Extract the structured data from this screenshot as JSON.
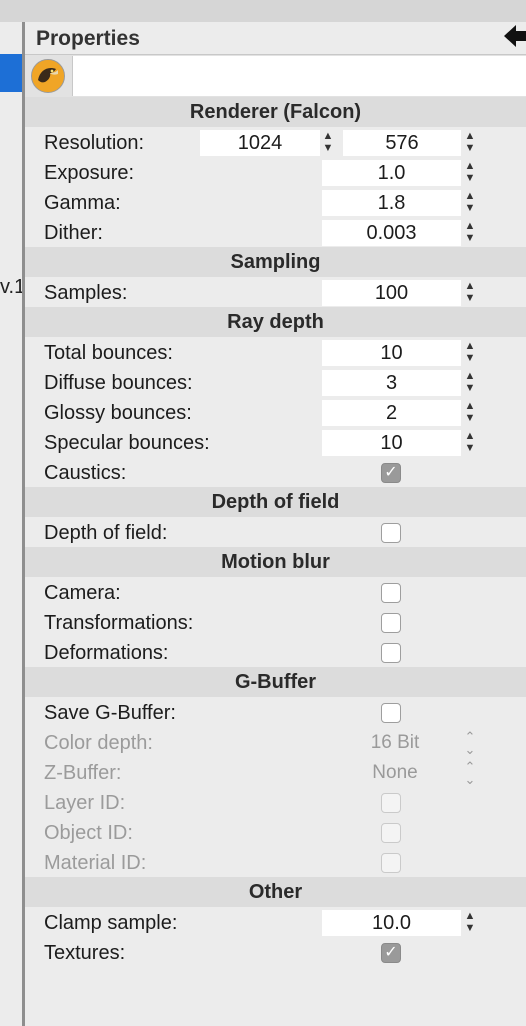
{
  "window": {
    "left_fragment": "v.1"
  },
  "panel": {
    "title": "Properties",
    "back_icon": "arrow-left-icon",
    "renderer_icon": "falcon-logo-icon"
  },
  "sections": {
    "renderer": "Renderer (Falcon)",
    "sampling": "Sampling",
    "ray_depth": "Ray depth",
    "dof": "Depth of field",
    "motion_blur": "Motion blur",
    "gbuffer": "G-Buffer",
    "other": "Other"
  },
  "renderer": {
    "resolution": {
      "label": "Resolution:",
      "width": "1024",
      "height": "576"
    },
    "exposure": {
      "label": "Exposure:",
      "value": "1.0"
    },
    "gamma": {
      "label": "Gamma:",
      "value": "1.8"
    },
    "dither": {
      "label": "Dither:",
      "value": "0.003"
    }
  },
  "sampling": {
    "samples": {
      "label": "Samples:",
      "value": "100"
    }
  },
  "ray_depth": {
    "total": {
      "label": "Total bounces:",
      "value": "10"
    },
    "diffuse": {
      "label": "Diffuse bounces:",
      "value": "3"
    },
    "glossy": {
      "label": "Glossy bounces:",
      "value": "2"
    },
    "specular": {
      "label": "Specular bounces:",
      "value": "10"
    },
    "caustics": {
      "label": "Caustics:",
      "checked": true
    }
  },
  "dof": {
    "dof": {
      "label": "Depth of field:",
      "checked": false
    }
  },
  "motion_blur": {
    "camera": {
      "label": "Camera:",
      "checked": false
    },
    "transformations": {
      "label": "Transformations:",
      "checked": false
    },
    "deformations": {
      "label": "Deformations:",
      "checked": false
    }
  },
  "gbuffer": {
    "save": {
      "label": "Save G-Buffer:",
      "checked": false
    },
    "color_depth": {
      "label": "Color depth:",
      "value": "16 Bit",
      "enabled": false
    },
    "zbuffer": {
      "label": "Z-Buffer:",
      "value": "None",
      "enabled": false
    },
    "layer_id": {
      "label": "Layer ID:",
      "checked": false,
      "enabled": false
    },
    "object_id": {
      "label": "Object ID:",
      "checked": false,
      "enabled": false
    },
    "material_id": {
      "label": "Material ID:",
      "checked": false,
      "enabled": false
    }
  },
  "other": {
    "clamp": {
      "label": "Clamp sample:",
      "value": "10.0"
    },
    "textures": {
      "label": "Textures:",
      "checked": true
    }
  },
  "glyphs": {
    "check": "✓",
    "up": "▲",
    "down": "▼",
    "chev_up": "⌃",
    "chev_down": "⌄",
    "back_arrow": "🡄"
  }
}
